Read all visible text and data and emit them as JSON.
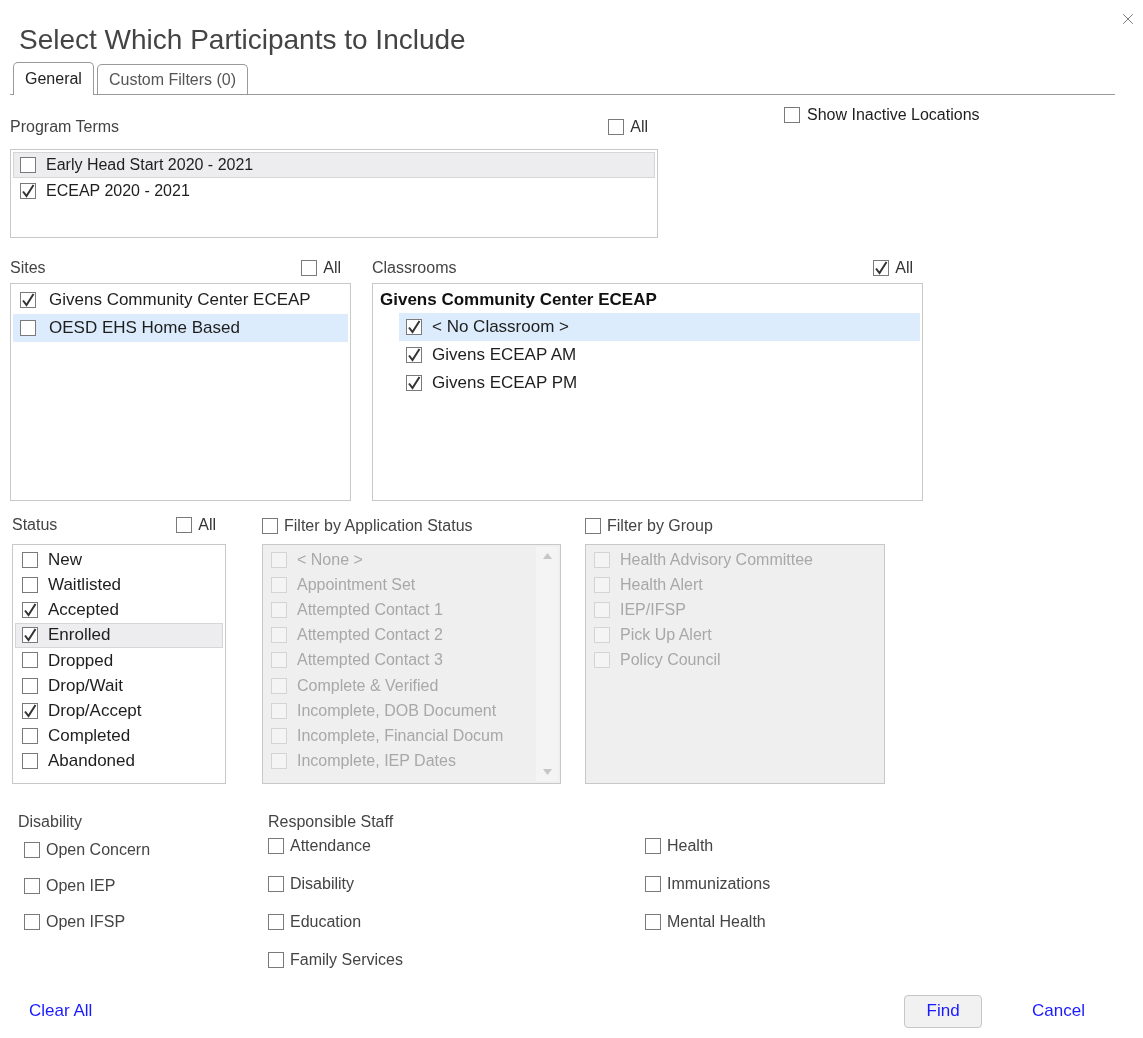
{
  "dialog": {
    "title": "Select Which Participants to Include"
  },
  "tabs": [
    {
      "label": "General",
      "selected": true
    },
    {
      "label": "Custom Filters (0)",
      "selected": false
    }
  ],
  "show_inactive_locations": {
    "label": "Show Inactive Locations",
    "checked": false
  },
  "program_terms": {
    "label": "Program Terms",
    "all": {
      "label": "All",
      "checked": false
    },
    "items": [
      {
        "label": "Early Head Start 2020 - 2021",
        "checked": false,
        "focused": true,
        "selected": false
      },
      {
        "label": "ECEAP 2020 - 2021",
        "checked": true,
        "focused": false,
        "selected": false
      }
    ]
  },
  "sites": {
    "label": "Sites",
    "all": {
      "label": "All",
      "checked": false
    },
    "items": [
      {
        "label": "Givens Community Center ECEAP",
        "checked": true,
        "focused": false,
        "selected": false
      },
      {
        "label": "OESD EHS Home Based",
        "checked": false,
        "focused": false,
        "selected": true
      }
    ]
  },
  "classrooms": {
    "label": "Classrooms",
    "all": {
      "label": "All",
      "checked": true
    },
    "groups": [
      {
        "label": "Givens Community Center ECEAP",
        "items": [
          {
            "label": "< No Classroom >",
            "checked": true,
            "focused": false,
            "selected": true
          },
          {
            "label": "Givens ECEAP AM",
            "checked": true,
            "focused": false,
            "selected": false
          },
          {
            "label": "Givens ECEAP PM",
            "checked": true,
            "focused": false,
            "selected": false
          }
        ]
      }
    ]
  },
  "status": {
    "label": "Status",
    "all": {
      "label": "All",
      "checked": false
    },
    "items": [
      {
        "label": "New",
        "checked": false,
        "focused": false,
        "selected": false
      },
      {
        "label": "Waitlisted",
        "checked": false,
        "focused": false,
        "selected": false
      },
      {
        "label": "Accepted",
        "checked": true,
        "focused": false,
        "selected": false
      },
      {
        "label": "Enrolled",
        "checked": true,
        "focused": true,
        "selected": false
      },
      {
        "label": "Dropped",
        "checked": false,
        "focused": false,
        "selected": false
      },
      {
        "label": "Drop/Wait",
        "checked": false,
        "focused": false,
        "selected": false
      },
      {
        "label": "Drop/Accept",
        "checked": true,
        "focused": false,
        "selected": false
      },
      {
        "label": "Completed",
        "checked": false,
        "focused": false,
        "selected": false
      },
      {
        "label": "Abandoned",
        "checked": false,
        "focused": false,
        "selected": false
      }
    ]
  },
  "application_status": {
    "label": "Filter by Application Status",
    "checked": false,
    "disabled": true,
    "items": [
      {
        "label": "< None >",
        "checked": false
      },
      {
        "label": "Appointment Set",
        "checked": false
      },
      {
        "label": "Attempted Contact 1",
        "checked": false
      },
      {
        "label": "Attempted Contact 2",
        "checked": false
      },
      {
        "label": "Attempted Contact 3",
        "checked": false
      },
      {
        "label": "Complete & Verified",
        "checked": false
      },
      {
        "label": "Incomplete, DOB Document",
        "checked": false
      },
      {
        "label": "Incomplete, Financial Docum",
        "checked": false
      },
      {
        "label": "Incomplete, IEP Dates",
        "checked": false
      }
    ]
  },
  "group_filter": {
    "label": "Filter by Group",
    "checked": false,
    "disabled": true,
    "items": [
      {
        "label": "Health Advisory Committee",
        "checked": false
      },
      {
        "label": "Health Alert",
        "checked": false
      },
      {
        "label": "IEP/IFSP",
        "checked": false
      },
      {
        "label": "Pick Up Alert",
        "checked": false
      },
      {
        "label": "Policy Council",
        "checked": false
      }
    ]
  },
  "disability": {
    "label": "Disability",
    "items": [
      {
        "label": "Open Concern",
        "checked": false
      },
      {
        "label": "Open IEP",
        "checked": false
      },
      {
        "label": "Open IFSP",
        "checked": false
      }
    ]
  },
  "responsible_staff": {
    "label": "Responsible Staff",
    "columns": [
      [
        {
          "label": "Attendance",
          "checked": false
        },
        {
          "label": "Disability",
          "checked": false
        },
        {
          "label": "Education",
          "checked": false
        },
        {
          "label": "Family Services",
          "checked": false
        }
      ],
      [
        {
          "label": "Health",
          "checked": false
        },
        {
          "label": "Immunizations",
          "checked": false
        },
        {
          "label": "Mental Health",
          "checked": false
        }
      ]
    ]
  },
  "footer": {
    "clear_all": "Clear All",
    "find": "Find",
    "cancel": "Cancel"
  }
}
